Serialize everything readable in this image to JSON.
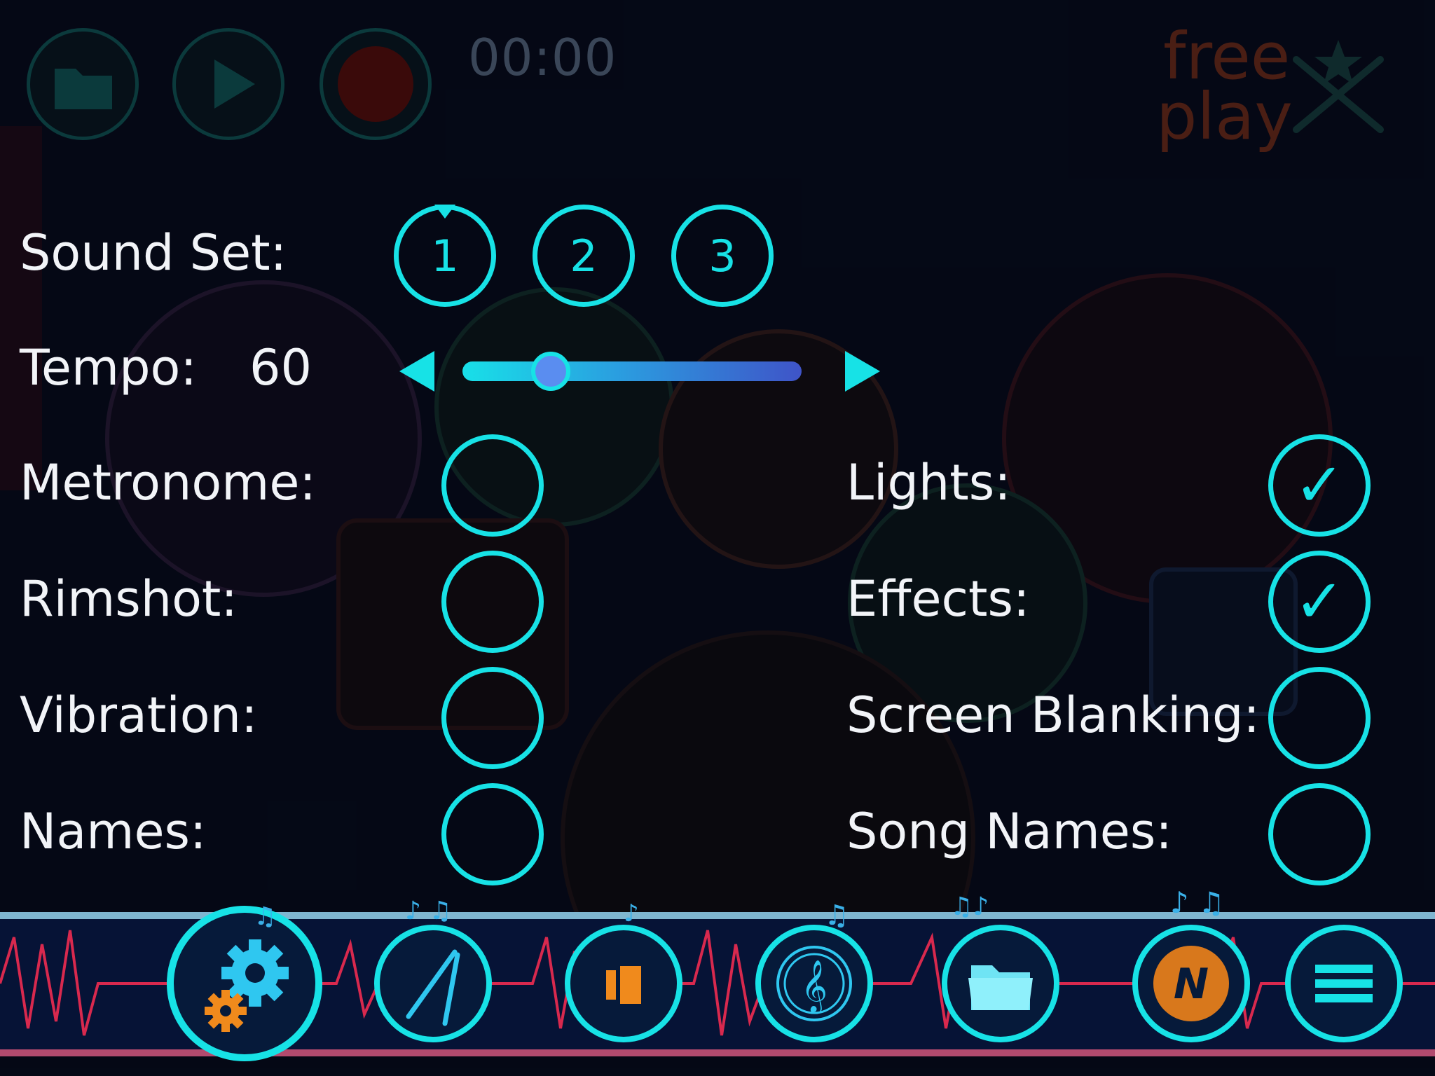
{
  "timer": "00:00",
  "logo": {
    "line1": "free",
    "line2": "play"
  },
  "colors": {
    "accent": "#17e2e6",
    "record": "#5a0c0c",
    "orange": "#f08a1c"
  },
  "settings": {
    "sound_set": {
      "label": "Sound Set:",
      "options": [
        "1",
        "2",
        "3"
      ],
      "selected": "1"
    },
    "tempo": {
      "label": "Tempo:",
      "value": "60",
      "fraction": 0.26
    },
    "left": [
      {
        "label": "Metronome:",
        "checked": false
      },
      {
        "label": "Rimshot:",
        "checked": false
      },
      {
        "label": "Vibration:",
        "checked": false
      },
      {
        "label": "Names:",
        "checked": false
      }
    ],
    "right": [
      {
        "label": "Lights:",
        "checked": true
      },
      {
        "label": "Effects:",
        "checked": true
      },
      {
        "label": "Screen Blanking:",
        "checked": false
      },
      {
        "label": "Song Names:",
        "checked": false
      }
    ]
  },
  "toolbar": {
    "items": [
      "settings-icon",
      "drumsticks-icon",
      "stop-play-icon",
      "treble-clef-icon",
      "folder-icon",
      "n-logo-icon",
      "menu-icon"
    ],
    "active": "settings-icon"
  }
}
